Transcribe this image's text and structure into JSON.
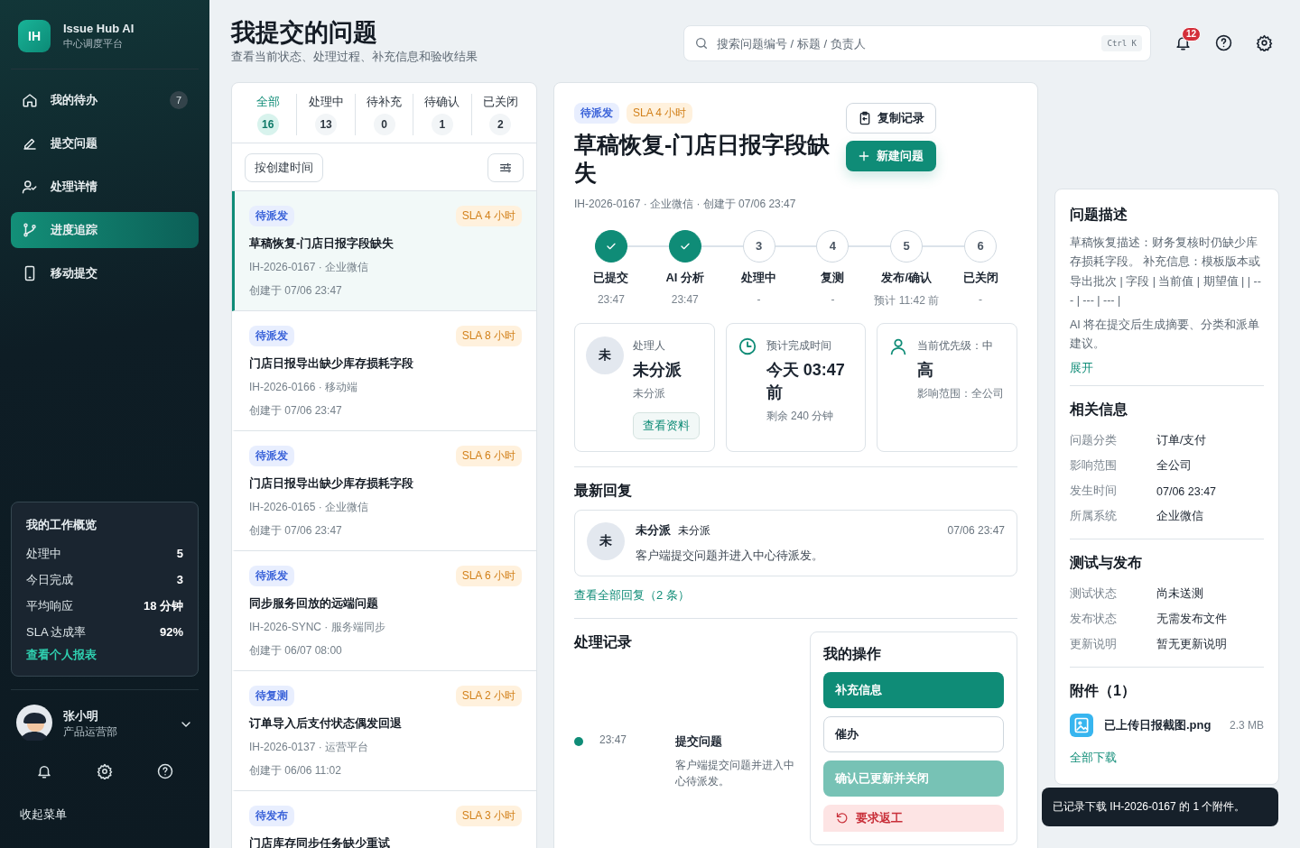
{
  "app": {
    "logo": "IH",
    "name": "Issue Hub AI",
    "subtitle": "中心调度平台"
  },
  "nav": [
    {
      "label": "我的待办",
      "badge": "7",
      "selected": false
    },
    {
      "label": "提交问题",
      "selected": false
    },
    {
      "label": "处理详情",
      "selected": false
    },
    {
      "label": "进度追踪",
      "selected": true
    },
    {
      "label": "移动提交",
      "selected": false
    }
  ],
  "overview": {
    "title": "我的工作概览",
    "rows": [
      {
        "label": "处理中",
        "value": "5"
      },
      {
        "label": "今日完成",
        "value": "3"
      },
      {
        "label": "平均响应",
        "value": "18 分钟"
      },
      {
        "label": "SLA 达成率",
        "value": "92%"
      }
    ],
    "link": "查看个人报表"
  },
  "user": {
    "name": "张小明",
    "department": "产品运营部"
  },
  "collapse": "收起菜单",
  "header": {
    "title": "我提交的问题",
    "subtitle": "查看当前状态、处理过程、补充信息和验收结果"
  },
  "search": {
    "placeholder": "搜索问题编号 / 标题 / 负责人",
    "shortcut": "Ctrl K"
  },
  "notifications": {
    "badge": "12"
  },
  "filters": [
    {
      "label": "全部",
      "count": "16",
      "selected": true
    },
    {
      "label": "处理中",
      "count": "13",
      "selected": false
    },
    {
      "label": "待补充",
      "count": "0",
      "selected": false
    },
    {
      "label": "待确认",
      "count": "1",
      "selected": false
    },
    {
      "label": "已关闭",
      "count": "2",
      "selected": false
    }
  ],
  "sort": "按创建时间",
  "issues": [
    {
      "status": "待派发",
      "sla": "SLA 4 小时",
      "title": "草稿恢复-门店日报字段缺失",
      "meta": "IH-2026-0167 · 企业微信",
      "created": "创建于 07/06 23:47",
      "selected": true
    },
    {
      "status": "待派发",
      "sla": "SLA 8 小时",
      "title": "门店日报导出缺少库存损耗字段",
      "meta": "IH-2026-0166 · 移动端",
      "created": "创建于 07/06 23:47",
      "selected": false
    },
    {
      "status": "待派发",
      "sla": "SLA 6 小时",
      "title": "门店日报导出缺少库存损耗字段",
      "meta": "IH-2026-0165 · 企业微信",
      "created": "创建于 07/06 23:47",
      "selected": false
    },
    {
      "status": "待派发",
      "sla": "SLA 6 小时",
      "title": "同步服务回放的远端问题",
      "meta": "IH-2026-SYNC · 服务端同步",
      "created": "创建于 06/07 08:00",
      "selected": false
    },
    {
      "status": "待复测",
      "sla": "SLA 2 小时",
      "title": "订单导入后支付状态偶发回退",
      "meta": "IH-2026-0137 · 运营平台",
      "created": "创建于 06/06 11:02",
      "selected": false
    },
    {
      "status": "待发布",
      "sla": "SLA 3 小时",
      "title": "门店库存同步任务缺少重试",
      "selected": false
    }
  ],
  "detail": {
    "tags": [
      {
        "text": "待派发",
        "kind": "status"
      },
      {
        "text": "SLA 4 小时",
        "kind": "sla"
      }
    ],
    "title": "草稿恢复-门店日报字段缺失",
    "meta": "IH-2026-0167 · 企业微信 · 创建于 07/06 23:47",
    "copy_button": "复制记录",
    "new_button": "新建问题",
    "steps": [
      {
        "label": "已提交",
        "time": "23:47",
        "done": true
      },
      {
        "label": "AI 分析",
        "time": "23:47",
        "done": true
      },
      {
        "number": "3",
        "label": "处理中",
        "time": "-",
        "done": false
      },
      {
        "number": "4",
        "label": "复测",
        "time": "-",
        "done": false
      },
      {
        "number": "5",
        "label": "发布/确认",
        "time": "预计 11:42 前",
        "done": false
      },
      {
        "number": "6",
        "label": "已关闭",
        "time": "-",
        "done": false
      }
    ],
    "cards": [
      {
        "kind": "assignee",
        "avatar": "未",
        "label": "处理人",
        "value": "未分派",
        "sub": "未分派",
        "button": "查看资料"
      },
      {
        "kind": "time",
        "label": "预计完成时间",
        "value": "今天 03:47 前",
        "sub": "剩余 240 分钟"
      },
      {
        "kind": "priority",
        "label": "当前优先级：中",
        "value": "高",
        "sub": "影响范围：全公司"
      }
    ],
    "reply": {
      "title": "最新回复",
      "avatar": "未",
      "name": "未分派",
      "role": "未分派",
      "time": "07/06 23:47",
      "text": "客户端提交问题并进入中心待派发。",
      "link": "查看全部回复（2 条）"
    },
    "records": {
      "title": "处理记录",
      "items": [
        {
          "time": "23:47",
          "title": "提交问题",
          "text": "客户端提交问题并进入中心待派发。"
        }
      ]
    },
    "actions": {
      "title": "我的操作",
      "buttons": [
        {
          "label": "补充信息",
          "kind": "primary"
        },
        {
          "label": "催办",
          "kind": "outline"
        },
        {
          "label": "确认已更新并关闭",
          "kind": "soft"
        },
        {
          "label": "要求返工",
          "kind": "danger"
        }
      ]
    }
  },
  "description": {
    "title": "问题描述",
    "paragraphs": [
      "草稿恢复描述：财务复核时仍缺少库存损耗字段。 补充信息：模板版本或导出批次 | 字段 | 当前值 | 期望值 | | --- | --- | --- |",
      "AI 将在提交后生成摘要、分类和派单建议。"
    ],
    "link": "展开"
  },
  "info_sections": [
    {
      "title": "相关信息",
      "rows": [
        {
          "label": "问题分类",
          "value": "订单/支付"
        },
        {
          "label": "影响范围",
          "value": "全公司"
        },
        {
          "label": "发生时间",
          "value": "07/06 23:47"
        },
        {
          "label": "所属系统",
          "value": "企业微信"
        }
      ]
    },
    {
      "title": "测试与发布",
      "rows": [
        {
          "label": "测试状态",
          "value": "尚未送测"
        },
        {
          "label": "发布状态",
          "value": "无需发布文件"
        },
        {
          "label": "更新说明",
          "value": "暂无更新说明"
        }
      ]
    }
  ],
  "attachments": {
    "title": "附件（1）",
    "files": [
      {
        "name": "已上传日报截图.png",
        "size": "2.3 MB"
      }
    ],
    "link": "全部下载"
  },
  "toast": "已记录下载 IH-2026-0167 的 1 个附件。"
}
